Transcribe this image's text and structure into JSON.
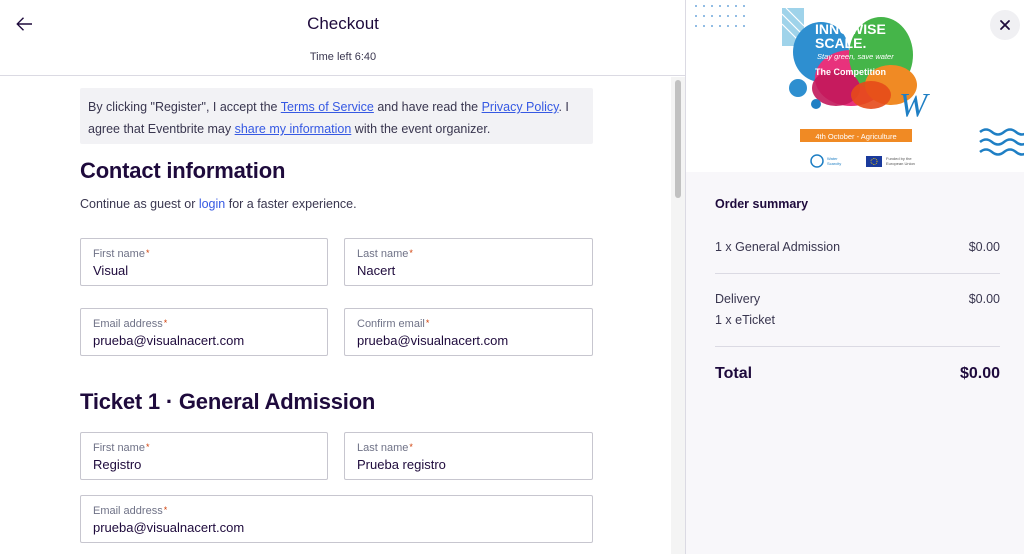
{
  "header": {
    "title": "Checkout",
    "time_left": "Time left 6:40"
  },
  "notice": {
    "part1": "By clicking \"Register\", I accept the ",
    "terms_link": "Terms of Service",
    "part2": " and have read the ",
    "privacy_link": "Privacy Policy",
    "part3": ". I agree that Eventbrite may ",
    "share_link": "share my information",
    "part4": " with the event organizer."
  },
  "contact": {
    "heading": "Contact information",
    "guest_prefix": "Continue as guest or ",
    "login_link": "login",
    "guest_suffix": " for a faster experience.",
    "first_name_label": "First name",
    "first_name_value": "Visual",
    "last_name_label": "Last name",
    "last_name_value": "Nacert",
    "email_label": "Email address",
    "email_value": "prueba@visualnacert.com",
    "confirm_email_label": "Confirm email",
    "confirm_email_value": "prueba@visualnacert.com",
    "required_mark": "*"
  },
  "ticket": {
    "heading": "Ticket 1 · General Admission",
    "first_name_label": "First name",
    "first_name_value": "Registro",
    "last_name_label": "Last name",
    "last_name_value": "Prueba registro",
    "email_label": "Email address",
    "email_value": "prueba@visualnacert.com"
  },
  "banner": {
    "line1": "INNOWISE",
    "line2": "SCALE.",
    "tagline": "Stay green, save water",
    "competition": "The Competition",
    "date_bar": "4th October - Agriculture",
    "logo_letter": "W",
    "partner1_line1": "Water",
    "partner1_line2": "Scarcity",
    "partner2_line1": "Funded by the",
    "partner2_line2": "European Union",
    "colors": {
      "blue": "#1f7fc4",
      "orange": "#f08a24",
      "pink": "#e8327c",
      "green": "#45b549",
      "bar": "#f08a24"
    }
  },
  "order_summary": {
    "title": "Order summary",
    "item_label": "1 x General Admission",
    "item_price": "$0.00",
    "delivery_label": "Delivery",
    "delivery_price": "$0.00",
    "delivery_detail": "1 x eTicket",
    "total_label": "Total",
    "total_value": "$0.00"
  },
  "icons": {
    "back": "arrow-left-icon",
    "close": "close-icon"
  },
  "colors": {
    "link": "#3659e3",
    "text": "#1e0a3c",
    "required": "#d1410c",
    "notice_bg": "#f2f2f5"
  }
}
